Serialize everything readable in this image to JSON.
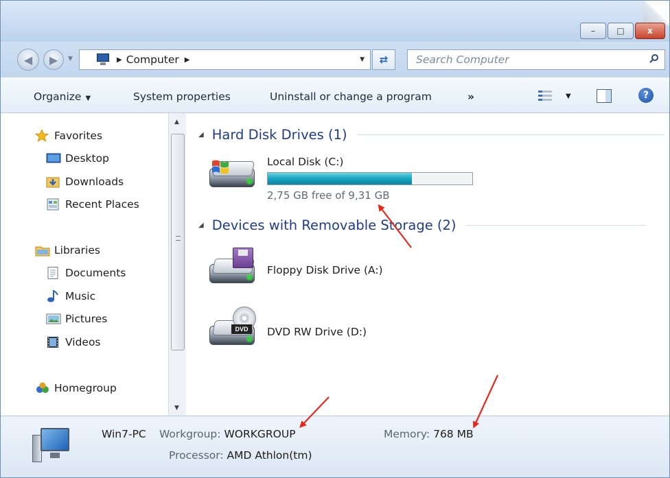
{
  "window": {
    "controls": {
      "minimize": "–",
      "maximize": "□",
      "close": "x"
    }
  },
  "nav": {
    "back_icon": "back-arrow-icon",
    "forward_icon": "forward-arrow-icon",
    "breadcrumb": [
      "Computer"
    ],
    "search_placeholder": "Search Computer"
  },
  "toolbar": {
    "organize": "Organize",
    "system_properties": "System properties",
    "uninstall": "Uninstall or change a program",
    "more": "»"
  },
  "sidebar": {
    "groups": [
      {
        "label": "Favorites",
        "icon": "star-icon",
        "items": [
          {
            "label": "Desktop",
            "icon": "desktop-icon"
          },
          {
            "label": "Downloads",
            "icon": "downloads-folder-icon"
          },
          {
            "label": "Recent Places",
            "icon": "recent-places-icon"
          }
        ]
      },
      {
        "label": "Libraries",
        "icon": "libraries-icon",
        "items": [
          {
            "label": "Documents",
            "icon": "documents-icon"
          },
          {
            "label": "Music",
            "icon": "music-icon"
          },
          {
            "label": "Pictures",
            "icon": "pictures-icon"
          },
          {
            "label": "Videos",
            "icon": "videos-icon"
          }
        ]
      },
      {
        "label": "Homegroup",
        "icon": "homegroup-icon",
        "items": []
      }
    ]
  },
  "content": {
    "groups": [
      {
        "title": "Hard Disk Drives (1)",
        "drives": [
          {
            "name": "Local Disk (C:)",
            "free_text": "2,75 GB free of 9,31 GB",
            "used_fraction": 0.705
          }
        ]
      },
      {
        "title": "Devices with Removable Storage (2)",
        "drives": [
          {
            "name": "Floppy Disk Drive (A:)"
          },
          {
            "name": "DVD RW Drive (D:)"
          }
        ]
      }
    ]
  },
  "details": {
    "computer_name": "Win7-PC",
    "workgroup_label": "Workgroup:",
    "workgroup_value": "WORKGROUP",
    "memory_label": "Memory:",
    "memory_value": "768 MB",
    "processor_label": "Processor:",
    "processor_value": "AMD Athlon(tm)"
  },
  "colors": {
    "group_header": "#1f3c88",
    "drive_fill": "#17a5c0",
    "annotation_arrow": "#e8261b"
  }
}
